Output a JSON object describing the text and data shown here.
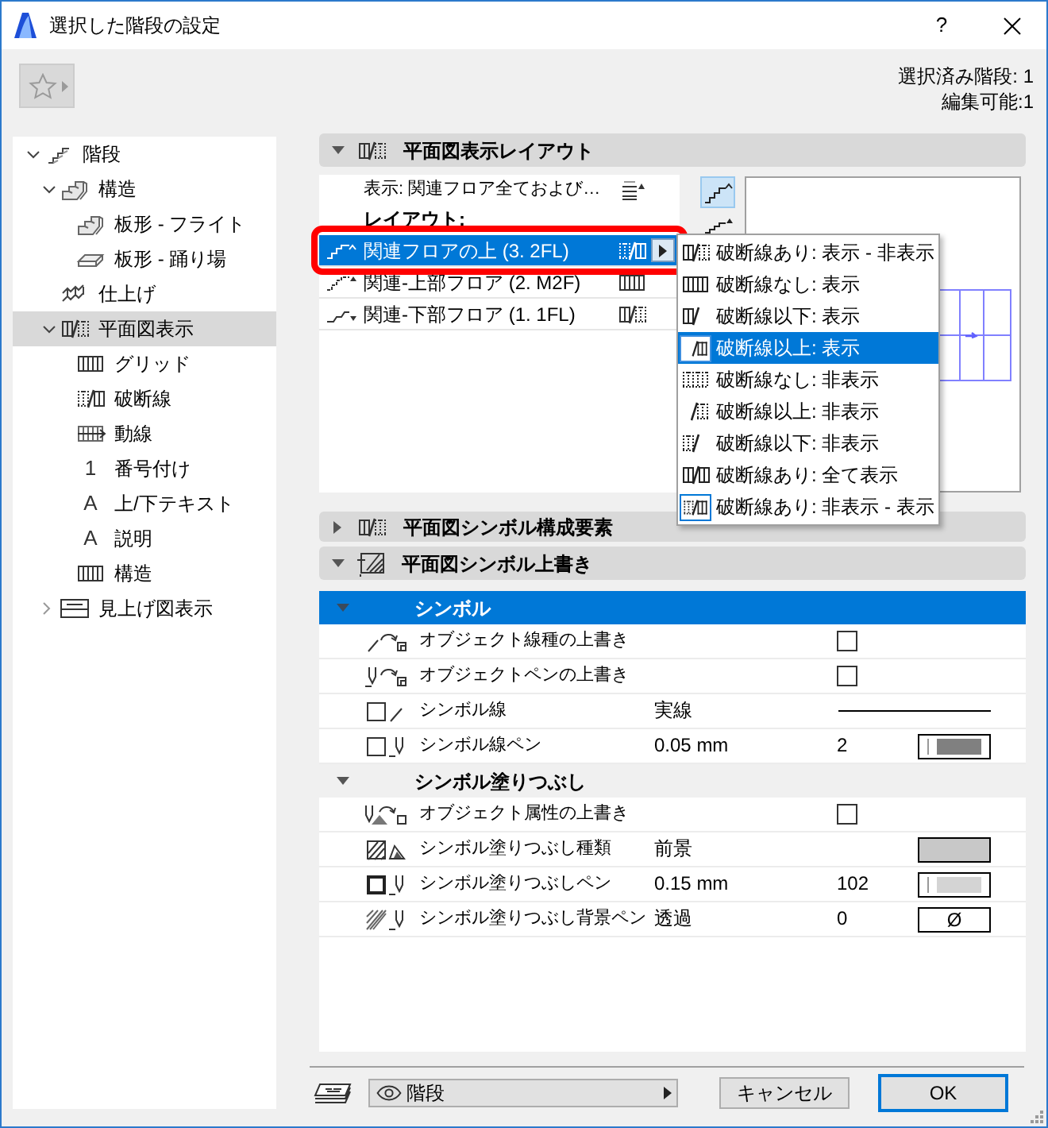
{
  "window": {
    "title": "選択した階段の設定",
    "help": "?"
  },
  "toolbar": {
    "info": [
      "選択済み階段: 1",
      "編集可能:1"
    ]
  },
  "tree": [
    {
      "label": "階段",
      "expanded": true,
      "selected": false,
      "children": [
        {
          "label": "構造",
          "expanded": true,
          "selected": false,
          "children": [
            {
              "label": "板形 - フライト",
              "selected": false
            },
            {
              "label": "板形 - 踊り場",
              "selected": false
            }
          ]
        },
        {
          "label": "仕上げ",
          "selected": false
        },
        {
          "label": "平面図表示",
          "expanded": true,
          "selected": true,
          "children": [
            {
              "label": "グリッド",
              "selected": false
            },
            {
              "label": "破断線",
              "selected": false
            },
            {
              "label": "動線",
              "selected": false
            },
            {
              "label": "番号付け",
              "glyph": "1",
              "selected": false
            },
            {
              "label": "上/下テキスト",
              "glyph": "A",
              "selected": false
            },
            {
              "label": "説明",
              "glyph": "A",
              "selected": false
            },
            {
              "label": "構造",
              "selected": false
            }
          ]
        },
        {
          "label": "見上げ図表示",
          "expanded": false,
          "selected": false
        }
      ]
    }
  ],
  "layout_section": {
    "title": "平面図表示レイアウト",
    "expanded": true,
    "display": "表示: 関連フロア全ておよび…",
    "layout_label": "レイアウト:",
    "floors": [
      {
        "label": "関連フロアの上 (3. 2FL)",
        "selected": true,
        "highlighted": true
      },
      {
        "label": "関連-上部フロア (2. M2F)",
        "selected": false,
        "highlighted": false
      },
      {
        "label": "関連-下部フロア (1. 1FL)",
        "selected": false,
        "highlighted": false
      }
    ],
    "view_buttons": [
      {
        "selected": true
      },
      {
        "selected": false
      }
    ]
  },
  "break_line_menu": {
    "items": [
      {
        "label": "破断線あり: 表示 - 非表示",
        "selected": false,
        "current": false
      },
      {
        "label": "破断線なし: 表示",
        "selected": false,
        "current": false
      },
      {
        "label": "破断線以下: 表示",
        "selected": false,
        "current": false
      },
      {
        "label": "破断線以上: 表示",
        "selected": true,
        "current": false
      },
      {
        "label": "破断線なし: 非表示",
        "selected": false,
        "current": false
      },
      {
        "label": "破断線以上: 非表示",
        "selected": false,
        "current": false
      },
      {
        "label": "破断線以下: 非表示",
        "selected": false,
        "current": false
      },
      {
        "label": "破断線あり: 全て表示",
        "selected": false,
        "current": false
      },
      {
        "label": "破断線あり: 非表示 - 表示",
        "selected": false,
        "current": true
      }
    ]
  },
  "components_section": {
    "title": "平面図シンボル構成要素",
    "expanded": false
  },
  "override_section": {
    "title": "平面図シンボル上書き",
    "expanded": true,
    "rows": [
      {
        "kind": "group",
        "label": "シンボル",
        "expanded": true,
        "selected": true
      },
      {
        "kind": "checkbox",
        "label": "オブジェクト線種の上書き",
        "checked": false
      },
      {
        "kind": "checkbox",
        "label": "オブジェクトペンの上書き",
        "checked": false
      },
      {
        "kind": "line",
        "label": "シンボル線",
        "value": "実線"
      },
      {
        "kind": "pen",
        "label": "シンボル線ペン",
        "value": "0.05 mm",
        "number": "2",
        "color": "#808080"
      },
      {
        "kind": "group",
        "label": "シンボル塗りつぶし",
        "expanded": true,
        "selected": false
      },
      {
        "kind": "checkbox",
        "label": "オブジェクト属性の上書き",
        "checked": false
      },
      {
        "kind": "fill",
        "label": "シンボル塗りつぶし種類",
        "value": "前景",
        "color": "#c8c8c8"
      },
      {
        "kind": "pen",
        "label": "シンボル塗りつぶしペン",
        "value": "0.15 mm",
        "number": "102",
        "color": "#d4d4d4"
      },
      {
        "kind": "pen",
        "label": "シンボル塗りつぶし背景ペン",
        "value": "透過",
        "number": "0",
        "swatch_text": "Ø"
      }
    ]
  },
  "footer": {
    "layer": "階段",
    "cancel": "キャンセル",
    "ok": "OK"
  }
}
